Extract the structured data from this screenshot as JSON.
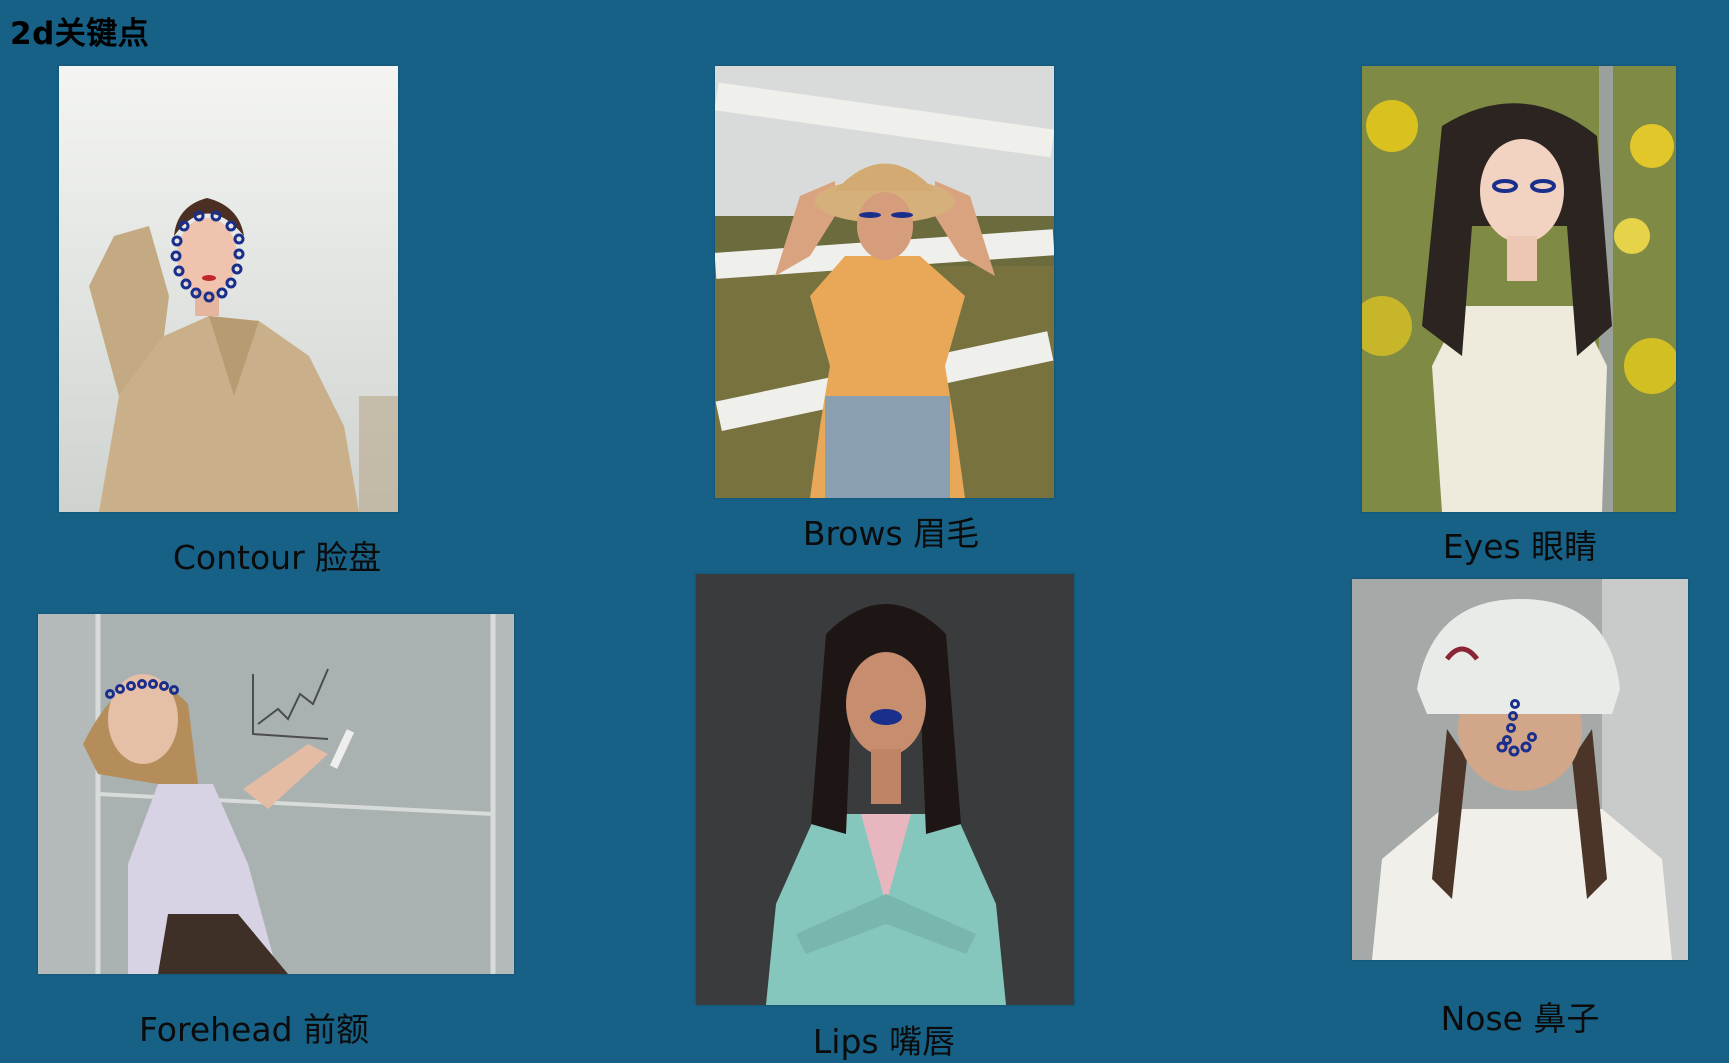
{
  "page": {
    "title": "2d关键点"
  },
  "cards": {
    "contour": {
      "caption": "Contour 脸盘"
    },
    "brows": {
      "caption": "Brows 眉毛"
    },
    "eyes": {
      "caption": "Eyes 眼睛"
    },
    "forehead": {
      "caption": "Forehead 前额"
    },
    "lips": {
      "caption": "Lips 嘴唇"
    },
    "nose": {
      "caption": "Nose 鼻子"
    }
  },
  "colors": {
    "background": "#176086",
    "keypoint": "#1a2f8c",
    "text": "#0b0b0b"
  }
}
